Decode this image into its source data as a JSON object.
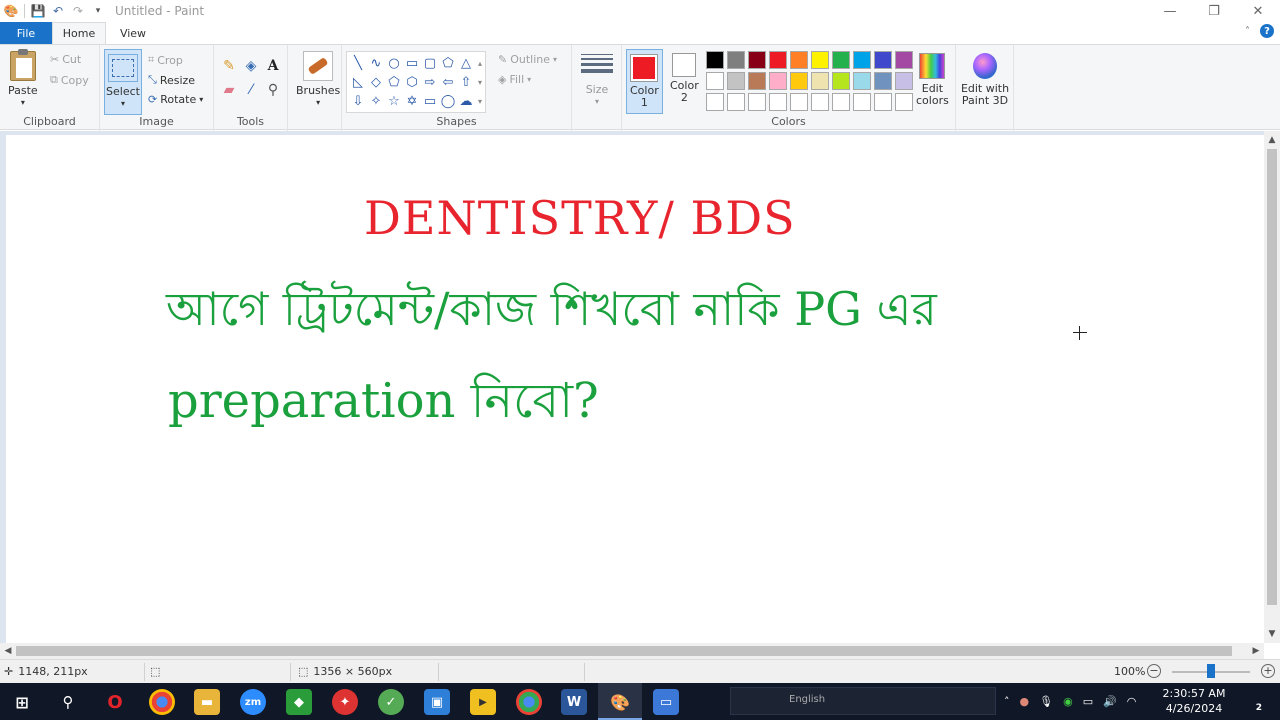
{
  "window": {
    "title": "Untitled - Paint",
    "controls": [
      "—",
      "❐",
      "✕"
    ]
  },
  "tabs": {
    "file": "File",
    "home": "Home",
    "view": "View"
  },
  "ribbon": {
    "clipboard": {
      "label": "Clipboard",
      "paste": "Paste",
      "cut": "Cut",
      "copy": "Copy"
    },
    "image": {
      "label": "Image",
      "select": "Select",
      "crop": "Crop",
      "resize": "Resize",
      "rotate": "Rotate"
    },
    "tools": {
      "label": "Tools"
    },
    "brushes": {
      "label": "Brushes"
    },
    "shapes": {
      "label": "Shapes",
      "outline": "Outline",
      "fill": "Fill"
    },
    "size": {
      "label": "Size"
    },
    "colors": {
      "label": "Colors",
      "color1": "Color\n1",
      "color1_l1": "Color",
      "color1_l2": "1",
      "color2_l1": "Color",
      "color2_l2": "2",
      "color1_value": "#ed1c24",
      "color2_value": "#ffffff",
      "edit_colors_l1": "Edit",
      "edit_colors_l2": "colors",
      "paint3d_l1": "Edit with",
      "paint3d_l2": "Paint 3D",
      "palette": [
        "#000000",
        "#7f7f7f",
        "#880015",
        "#ed1c24",
        "#ff7f27",
        "#fff200",
        "#22b14c",
        "#00a2e8",
        "#3f48cc",
        "#a349a4",
        "#ffffff",
        "#c3c3c3",
        "#b97a57",
        "#ffaec9",
        "#ffc90e",
        "#efe4b0",
        "#b5e61d",
        "#99d9ea",
        "#7092be",
        "#c8bfe7",
        "#ffffff",
        "#ffffff",
        "#ffffff",
        "#ffffff",
        "#ffffff",
        "#ffffff",
        "#ffffff",
        "#ffffff",
        "#ffffff",
        "#ffffff"
      ]
    }
  },
  "canvas": {
    "line1": "DENTISTRY/ BDS",
    "line2": "আগে ট্রিটমেন্ট/কাজ শিখবো নাকি PG এর",
    "line3": "preparation নিবো?",
    "line1_color": "#e8252e",
    "text_color": "#1aa03c"
  },
  "status": {
    "cursor_pos": "1148, 211px",
    "canvas_size": "1356 × 560px",
    "zoom": "100%"
  },
  "taskbar": {
    "language": "English",
    "time": "2:30:57 AM",
    "date": "4/26/2024",
    "notifications": "2"
  }
}
